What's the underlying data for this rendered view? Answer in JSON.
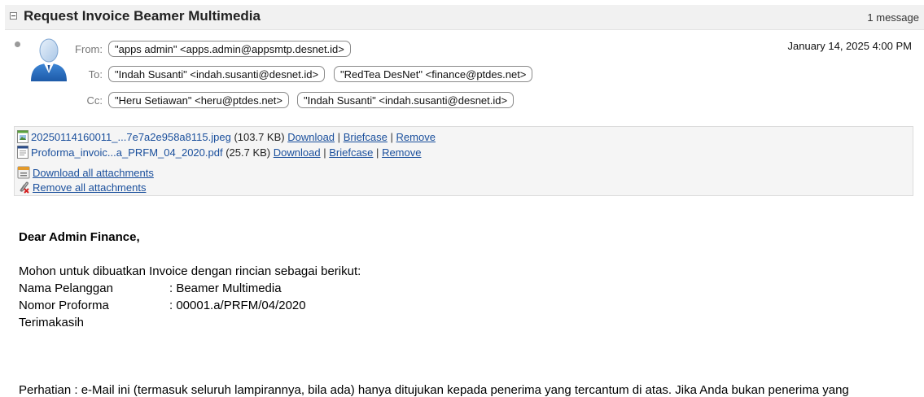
{
  "header": {
    "subject": "Request Invoice Beamer Multimedia",
    "message_count": "1 message"
  },
  "message": {
    "from_label": "From:",
    "to_label": "To:",
    "cc_label": "Cc:",
    "from": "\"apps admin\" <apps.admin@appsmtp.desnet.id>",
    "to": [
      "\"Indah Susanti\" <indah.susanti@desnet.id>",
      "\"RedTea DesNet\" <finance@ptdes.net>"
    ],
    "cc": [
      "\"Heru Setiawan\" <heru@ptdes.net>",
      "\"Indah Susanti\" <indah.susanti@desnet.id>"
    ],
    "date": "January 14, 2025 4:00 PM"
  },
  "attachments": {
    "items": [
      {
        "name": "20250114160011_...7e7a2e958a8115.jpeg",
        "size": "(103.7 KB)",
        "icon": "image-file-icon"
      },
      {
        "name": "Proforma_invoic...a_PRFM_04_2020.pdf",
        "size": "(25.7 KB)",
        "icon": "pdf-file-icon"
      }
    ],
    "download_label": "Download",
    "briefcase_label": "Briefcase",
    "remove_label": "Remove",
    "separator": "|",
    "download_all": "Download all attachments",
    "remove_all": "Remove all attachments"
  },
  "body": {
    "greeting": "Dear Admin Finance,",
    "intro": "Mohon untuk dibuatkan Invoice dengan rincian sebagai berikut:",
    "fields": [
      {
        "key": "Nama Pelanggan",
        "value": ": Beamer Multimedia"
      },
      {
        "key": "Nomor Proforma",
        "value": ": 00001.a/PRFM/04/2020"
      }
    ],
    "closing": "Terimakasih",
    "disclaimer": "Perhatian : e-Mail ini (termasuk seluruh lampirannya, bila ada) hanya ditujukan kepada penerima yang tercantum di atas. Jika Anda bukan penerima yang"
  }
}
